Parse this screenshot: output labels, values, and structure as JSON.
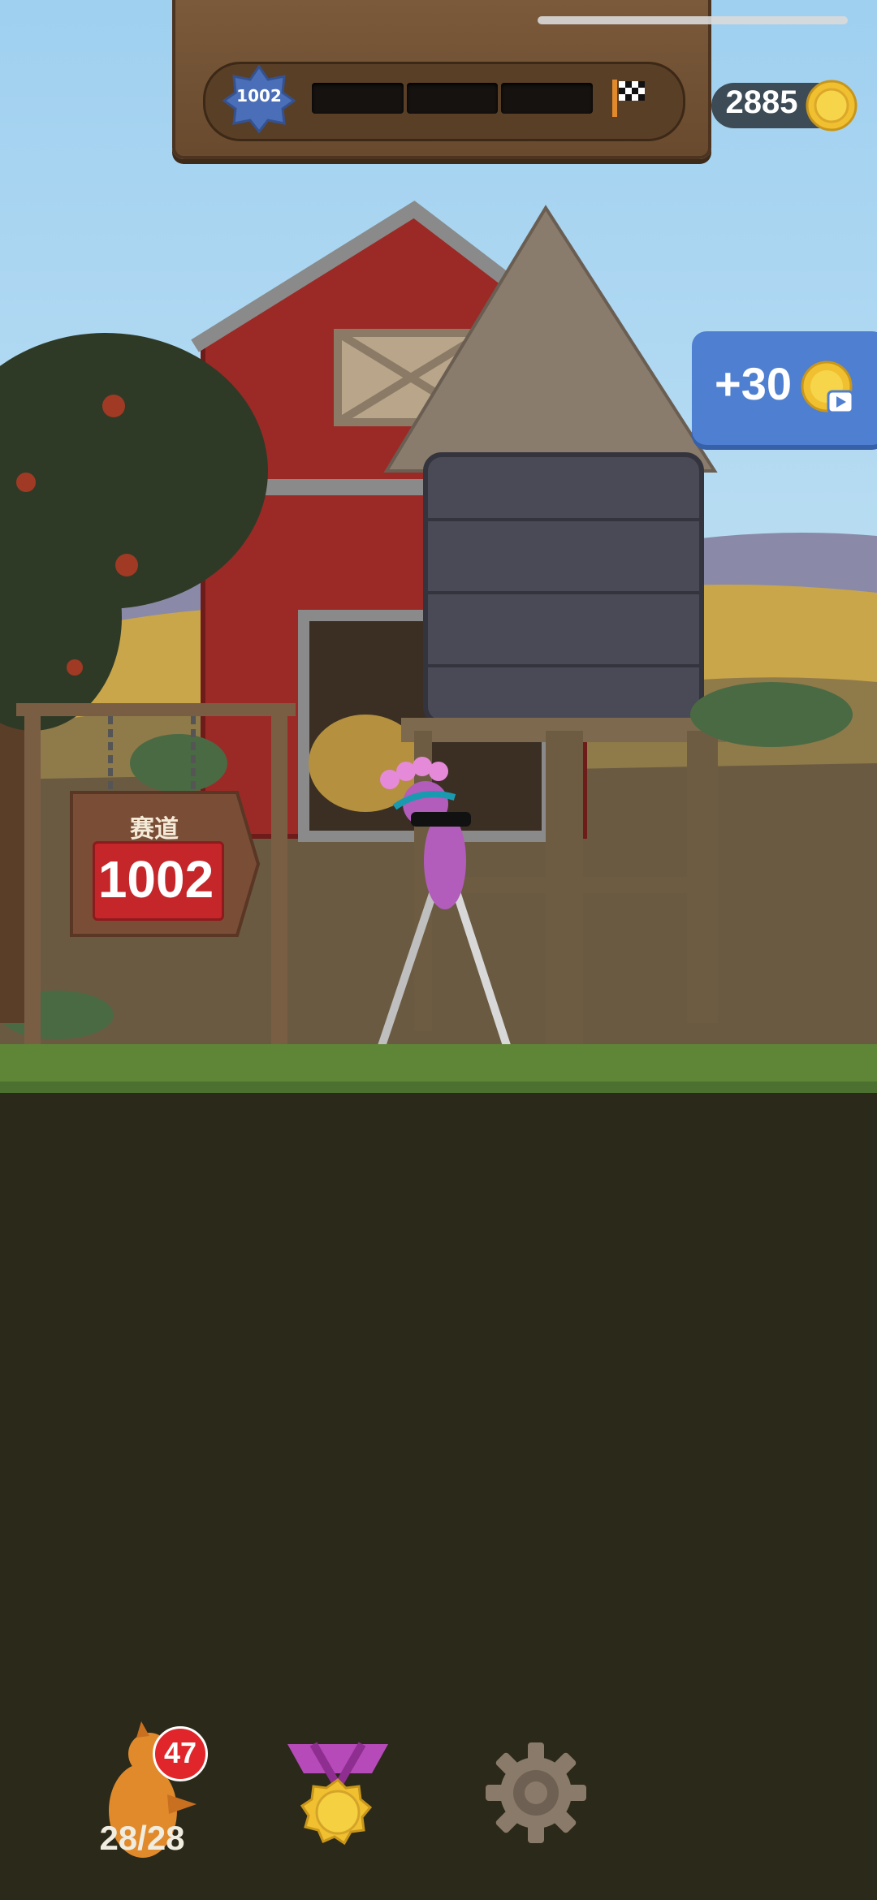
{
  "hud": {
    "level_badge": "1002",
    "progress_segments": 3,
    "coins": "2885"
  },
  "reward": {
    "label": "+30"
  },
  "course_sign": {
    "label": "赛道",
    "number": "1002"
  },
  "bottom_bar": {
    "character_badge": "47",
    "character_count": "28/28"
  },
  "icons": [
    "level-star-icon",
    "finish-flag-icon",
    "coin-icon",
    "video-ad-icon",
    "character-icon",
    "medal-icon",
    "gear-icon"
  ],
  "colors": {
    "sky": "#a7d4ef",
    "coin": "#f0c030",
    "reward_button": "#4f7fd0",
    "badge_red": "#e0262a",
    "grass": "#5f8637",
    "ground": "#2b2919"
  }
}
